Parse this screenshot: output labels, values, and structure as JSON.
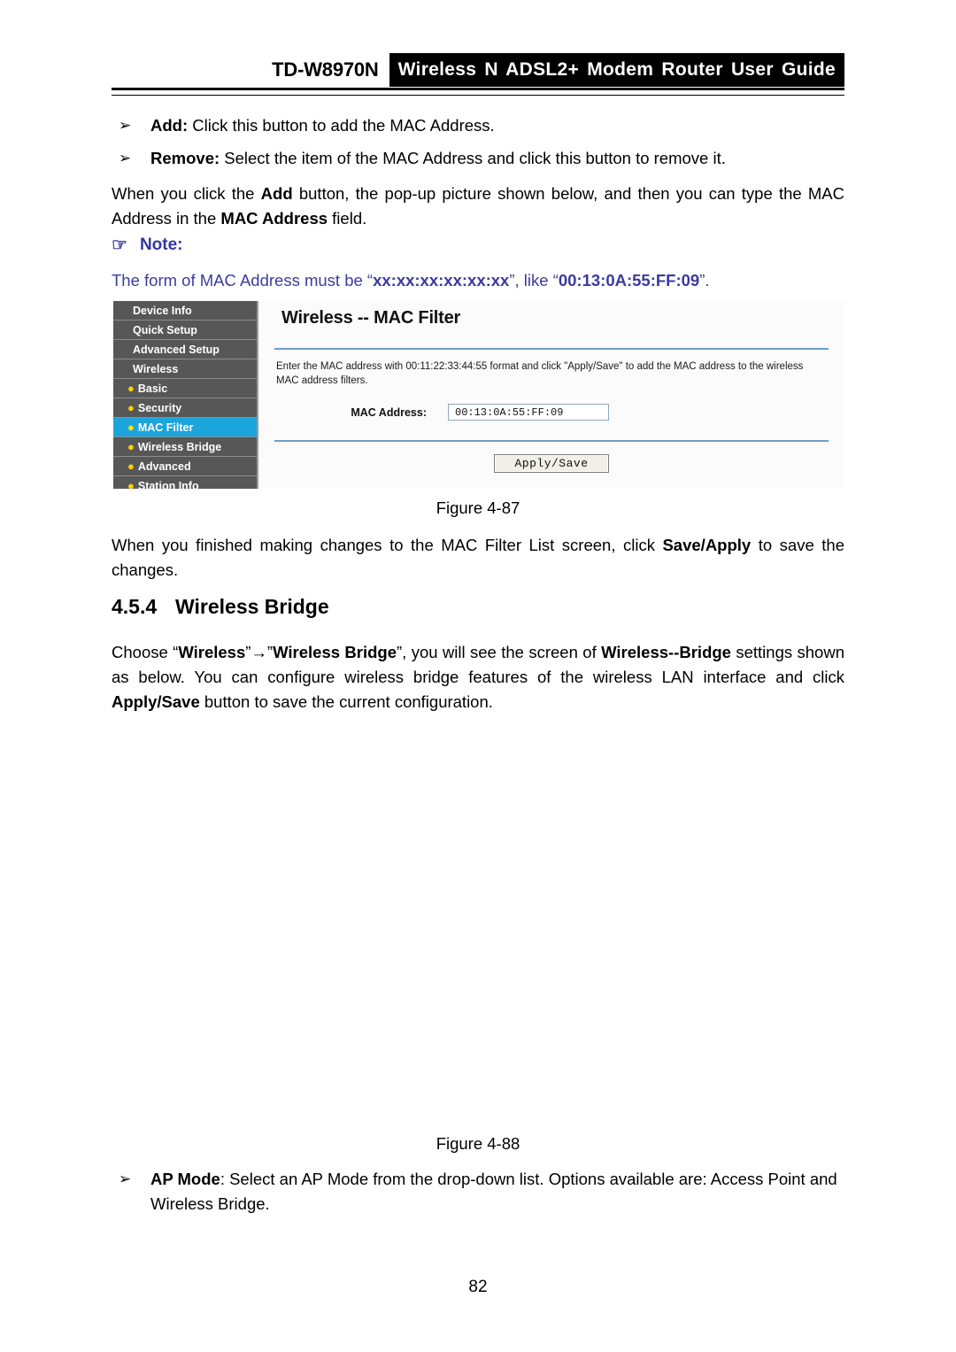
{
  "header": {
    "model": "TD-W8970N",
    "title": "Wireless N ADSL2+ Modem Router User Guide"
  },
  "bullets": {
    "glyph": "➢",
    "add": {
      "term": "Add:",
      "text": " Click this button to add the MAC Address."
    },
    "remove": {
      "term": "Remove:",
      "text": " Select the item of the MAC Address and click this button to remove it."
    },
    "ap_mode": {
      "term": "AP Mode",
      "text": ": Select an AP Mode from the drop-down list. Options available are: Access Point and Wireless Bridge."
    }
  },
  "paragraphs": {
    "add_popup_1": "When you click the ",
    "add_popup_bold1": "Add",
    "add_popup_2": " button, the pop-up picture shown below, and then you can type the MAC Address in the ",
    "add_popup_bold2": "MAC Address",
    "add_popup_3": " field.",
    "save_apply_1": "When you finished making changes to the MAC Filter List screen, click ",
    "save_apply_bold": "Save/Apply",
    "save_apply_2": " to save the changes.",
    "bridge_1": "Choose “",
    "bridge_b1": "Wireless",
    "bridge_2": "”→”",
    "bridge_b2": "Wireless Bridge",
    "bridge_3": "”, you will see the screen of ",
    "bridge_b3": "Wireless--Bridge",
    "bridge_4": " settings shown as below. You can configure wireless bridge features of the wireless LAN interface and click ",
    "bridge_b4": "Apply/Save",
    "bridge_5": " button to save the current configuration."
  },
  "note": {
    "hand_icon": "☞",
    "label": "Note:",
    "text_1": "The form of MAC Address must be “",
    "text_bold1": "xx:xx:xx:xx:xx:xx",
    "text_2": "”, like “",
    "text_bold2": "00:13:0A:55:FF:09",
    "text_3": "”."
  },
  "router_ui": {
    "menu": [
      {
        "label": "Device Info",
        "type": "top",
        "active": false
      },
      {
        "label": "Quick Setup",
        "type": "top",
        "active": false
      },
      {
        "label": "Advanced Setup",
        "type": "top",
        "active": false
      },
      {
        "label": "Wireless",
        "type": "top",
        "active": false
      },
      {
        "label": "Basic",
        "type": "sub",
        "active": false
      },
      {
        "label": "Security",
        "type": "sub",
        "active": false
      },
      {
        "label": "MAC Filter",
        "type": "sub",
        "active": true
      },
      {
        "label": "Wireless Bridge",
        "type": "sub",
        "active": false
      },
      {
        "label": "Advanced",
        "type": "sub",
        "active": false
      },
      {
        "label": "Station Info",
        "type": "sub",
        "active": false
      }
    ],
    "panel_title": "Wireless -- MAC Filter",
    "panel_desc": "Enter the MAC address with 00:11:22:33:44:55 format and click \"Apply/Save\" to add the MAC address to the wireless MAC address filters.",
    "field_label": "MAC Address:",
    "field_value": "00:13:0A:55:FF:09",
    "button_label": "Apply/Save",
    "accent_color": "#1ca5dd",
    "divider_color": "#6f9ec6",
    "sidebar_color": "#575757"
  },
  "captions": {
    "fig_87": "Figure 4-87",
    "fig_88": "Figure 4-88"
  },
  "section": {
    "number": "4.5.4",
    "title": "Wireless Bridge"
  },
  "footer": {
    "page_number": "82"
  }
}
